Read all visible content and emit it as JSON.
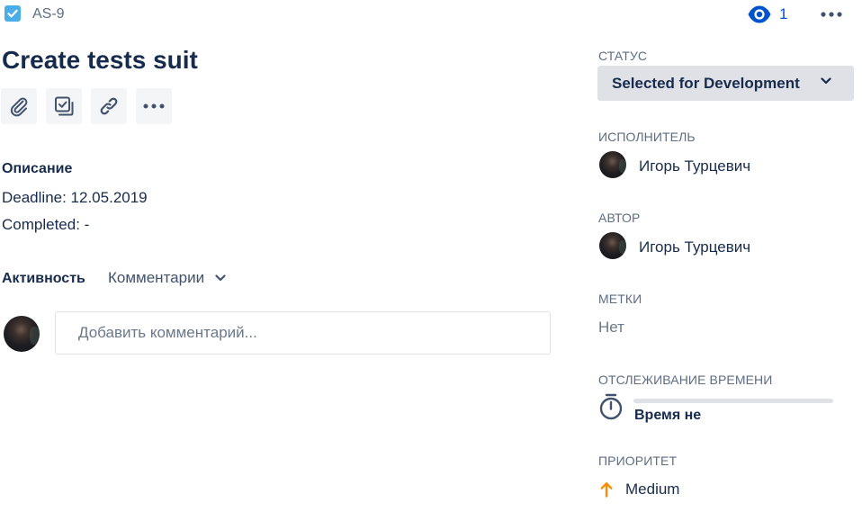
{
  "issue": {
    "key": "AS-9",
    "title": "Create tests suit",
    "watchers_count": "1"
  },
  "toolbar": {
    "icons": [
      "attachment-icon",
      "checklist-icon",
      "link-icon",
      "more-icon"
    ]
  },
  "description": {
    "heading": "Описание",
    "lines": [
      "Deadline: 12.05.2019",
      "Completed: -"
    ]
  },
  "activity": {
    "label": "Активность",
    "filter_label": "Комментарии",
    "comment_placeholder": "Добавить комментарий..."
  },
  "sidebar": {
    "status": {
      "label": "СТАТУС",
      "value": "Selected for Development"
    },
    "assignee": {
      "label": "ИСПОЛНИТЕЛЬ",
      "name": "Игорь Турцевич"
    },
    "reporter": {
      "label": "АВТОР",
      "name": "Игорь Турцевич"
    },
    "labels": {
      "label": "МЕТКИ",
      "value": "Нет"
    },
    "time_tracking": {
      "label": "ОТСЛЕЖИВАНИЕ ВРЕМЕНИ",
      "text": "Время не",
      "progress": 0
    },
    "priority": {
      "label": "ПРИОРИТЕТ",
      "value": "Medium"
    }
  },
  "colors": {
    "accent": "#0052cc",
    "text": "#172b4d",
    "muted": "#5e6c84",
    "button_bg": "#f4f5f7",
    "status_bg": "#dfe1e6",
    "priority_medium": "#ff8b00",
    "issue_type": "#4bade8"
  }
}
